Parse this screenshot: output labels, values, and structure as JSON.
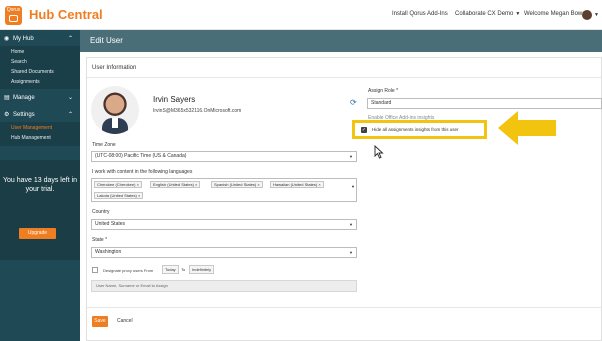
{
  "topbar": {
    "logo_text": "Qorus",
    "app_title": "Hub Central",
    "install_link": "Install Qorus Add-Ins",
    "tenant_menu": "Collaborate CX Demo",
    "welcome": "Welcome Megan Bowen"
  },
  "sidebar": {
    "my_hub": "My Hub",
    "my_hub_items": [
      "Home",
      "Search",
      "Shared Documents",
      "Assignments"
    ],
    "manage": "Manage",
    "settings": "Settings",
    "settings_items": [
      "User Management",
      "Hub Management"
    ],
    "trial_text": "You have 13 days left in your trial.",
    "upgrade": "Upgrade"
  },
  "page": {
    "title": "Edit User",
    "section": "User Information"
  },
  "user": {
    "name": "Irvin Sayers",
    "email": "IrvinS@M365x532116.OnMicrosoft.com"
  },
  "form": {
    "time_zone_label": "Time Zone",
    "time_zone_value": "(UTC-08:00) Pacific Time (US & Canada)",
    "languages_label": "I work with content in the following languages",
    "languages": [
      "Cherokee (Cherokee)",
      "English (United States)",
      "Spanish (United States)",
      "Hawaiian (United States)",
      "Lakota (United States)"
    ],
    "country_label": "Country",
    "country_value": "United States",
    "state_label": "State *",
    "state_value": "Washington",
    "proxy_label": "Designate proxy users From",
    "proxy_from": "Today",
    "proxy_to_label": "To",
    "proxy_to": "Indefinitely",
    "user_search_placeholder": "User Name, Surname or Email to Assign",
    "save": "Save",
    "cancel": "Cancel"
  },
  "role": {
    "label": "Assign Role *",
    "value": "Standard",
    "hint": "Enable Office Add-ins insights",
    "hide_insights_label": "Hide all assignments insights from this user",
    "hide_insights_checked": true
  },
  "colors": {
    "accent": "#ef7d22",
    "sidebar": "#1f4a55",
    "header": "#4a6e78",
    "highlight": "#f2c40f"
  }
}
